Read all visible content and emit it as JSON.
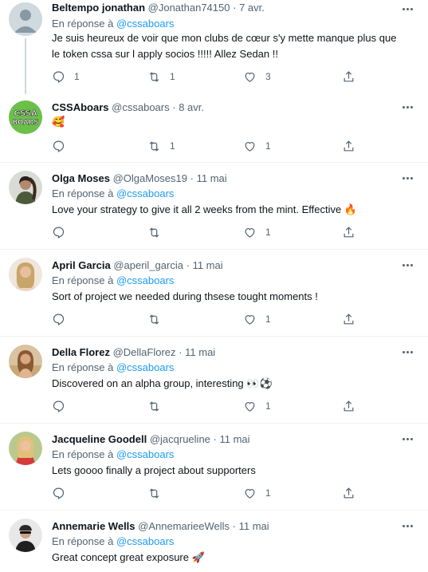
{
  "reply_prefix": "En réponse à",
  "tweets": [
    {
      "name": "Beltempo jonathan",
      "handle": "@Jonathan74150",
      "time": "7 avr.",
      "reply_to": "@cssaboars",
      "text": "Je suis heureux de voir que mon clubs de cœur s'y mette manque plus que le token cssa sur l apply socios !!!!! Allez Sedan !!",
      "replies": "1",
      "retweets": "1",
      "likes": "3",
      "avatar": "default-avatar"
    },
    {
      "name": "CSSAboars",
      "handle": "@cssaboars",
      "time": "8 avr.",
      "text": "🥰",
      "replies": "",
      "retweets": "1",
      "likes": "1",
      "avatar_logo_text": [
        "CSSA",
        "BOARS"
      ]
    },
    {
      "name": "Olga Moses",
      "handle": "@OlgaMoses19",
      "time": "11 mai",
      "reply_to": "@cssaboars",
      "text": "Love your strategy to give it all 2 weeks from the mint. Effective 🔥",
      "replies": "",
      "retweets": "",
      "likes": "1"
    },
    {
      "name": "April Garcia",
      "handle": "@aperil_garcia",
      "time": "11 mai",
      "reply_to": "@cssaboars",
      "text": "Sort of project we needed during thsese tought moments !",
      "replies": "",
      "retweets": "",
      "likes": "1"
    },
    {
      "name": "Della Florez",
      "handle": "@DellaFlorez",
      "time": "11 mai",
      "reply_to": "@cssaboars",
      "text": "Discovered on an alpha group, interesting 👀⚽",
      "replies": "",
      "retweets": "",
      "likes": "1"
    },
    {
      "name": "Jacqueline Goodell",
      "handle": "@jacqrueline",
      "time": "11 mai",
      "reply_to": "@cssaboars",
      "text": "Lets goooo finally a project about supporters",
      "replies": "",
      "retweets": "",
      "likes": "1"
    },
    {
      "name": "Annemarie Wells",
      "handle": "@AnnemarieeWells",
      "time": "11 mai",
      "reply_to": "@cssaboars",
      "text": "Great concept great exposure 🚀",
      "replies": "",
      "retweets": "",
      "likes": ""
    }
  ],
  "colors": {
    "accent": "#1d9bf0",
    "muted": "#536471",
    "text": "#0f1419",
    "divider": "#eff3f4"
  }
}
